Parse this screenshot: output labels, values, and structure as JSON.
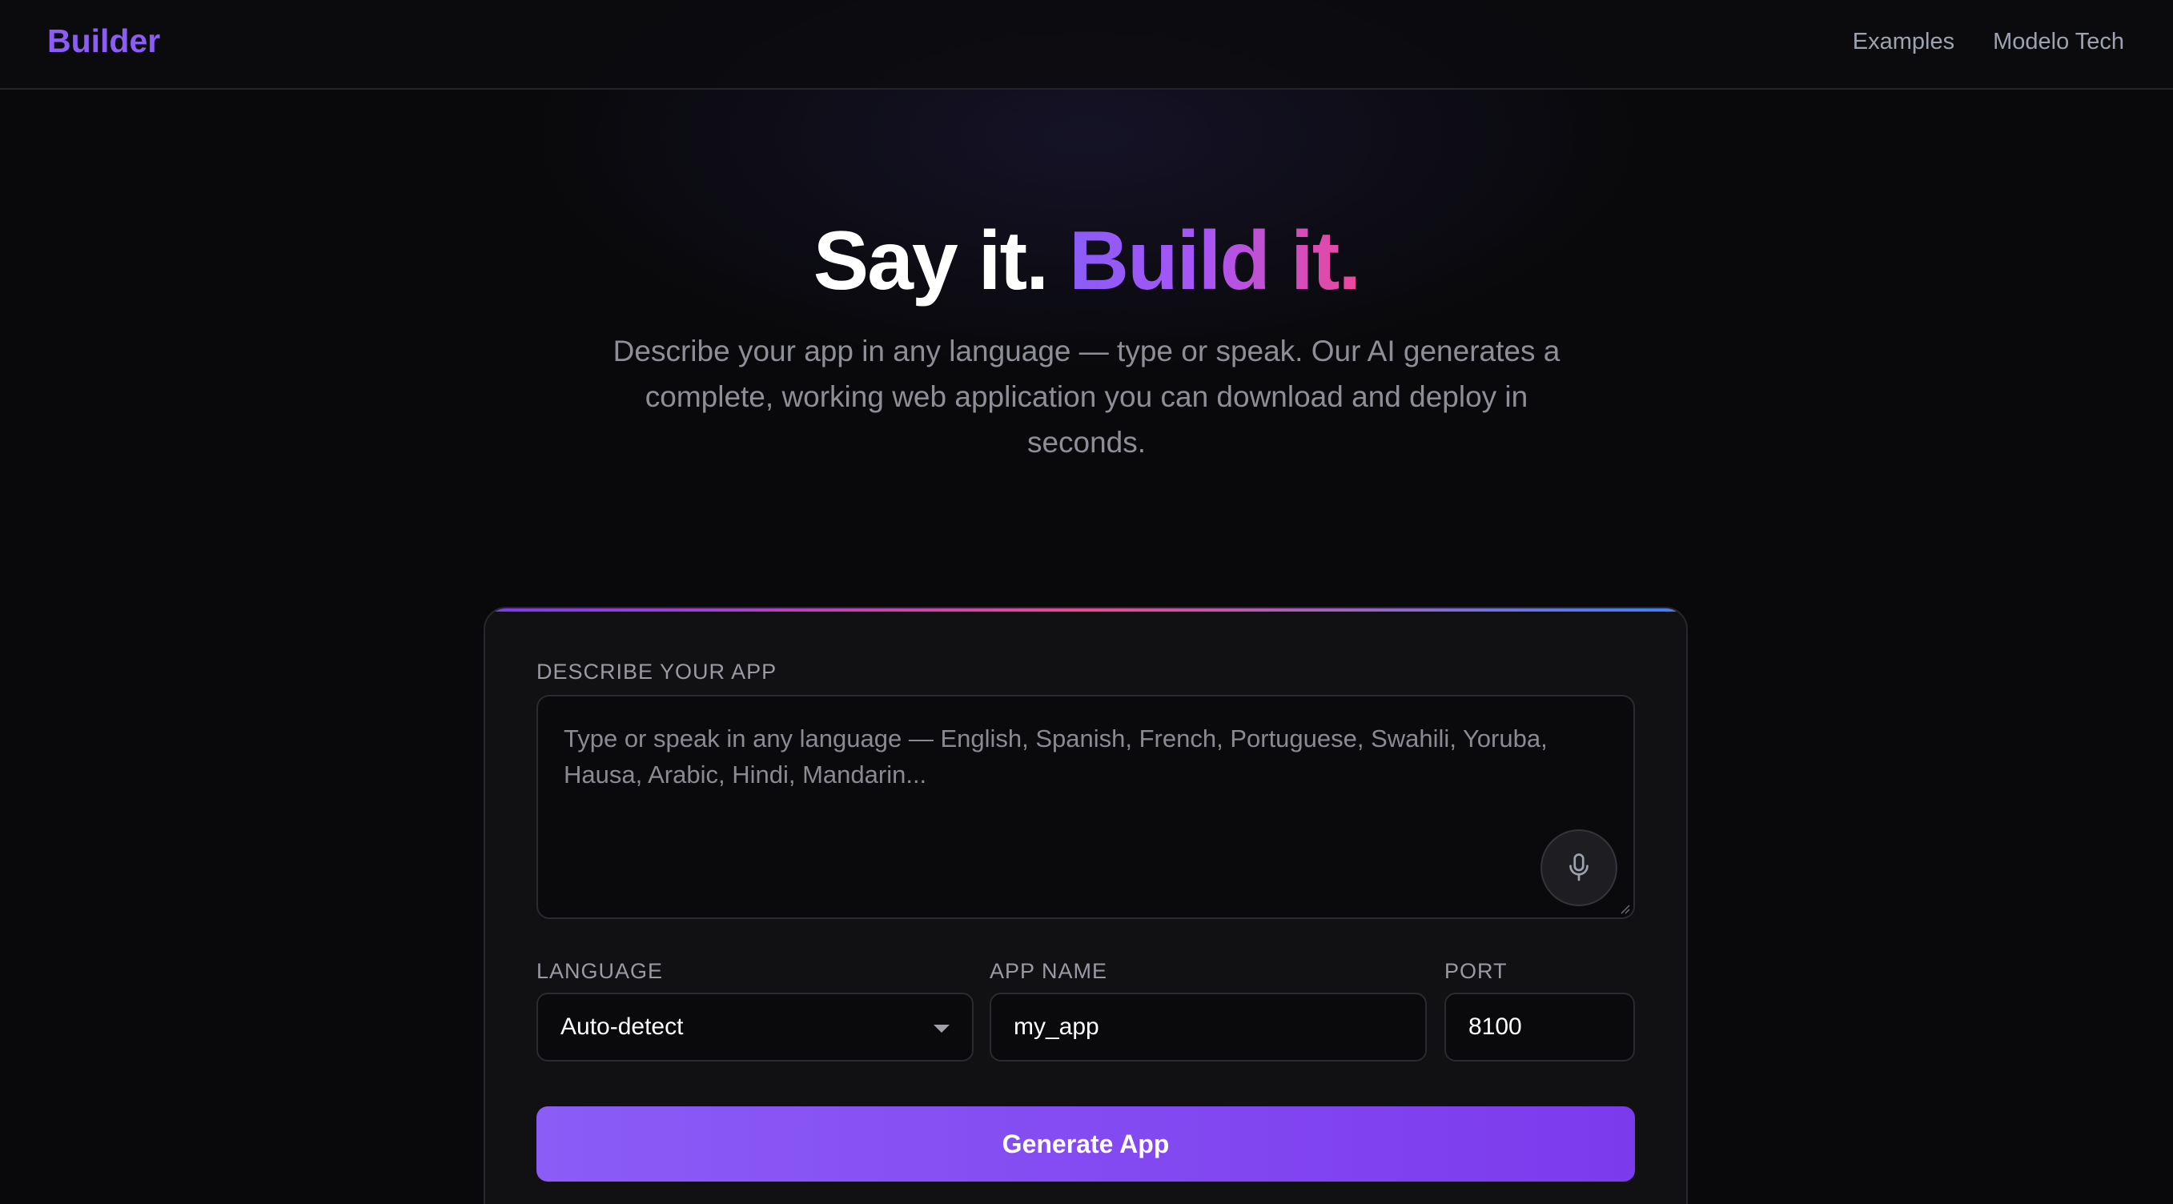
{
  "header": {
    "brand": "Builder",
    "nav": [
      "Examples",
      "Modelo Tech"
    ]
  },
  "hero": {
    "title_plain": "Say it.",
    "title_accent": "Build it.",
    "subtitle": "Describe your app in any language — type or speak. Our AI generates a complete, working web application you can download and deploy in seconds."
  },
  "form": {
    "describe_label": "DESCRIBE YOUR APP",
    "describe_placeholder": "Type or speak in any language — English, Spanish, French, Portuguese, Swahili, Yoruba, Hausa, Arabic, Hindi, Mandarin...",
    "language_label": "LANGUAGE",
    "language_value": "Auto-detect",
    "app_name_label": "APP NAME",
    "app_name_value": "my_app",
    "port_label": "PORT",
    "port_value": "8100",
    "generate_label": "Generate App",
    "mic_icon": "microphone-icon"
  },
  "colors": {
    "background": "#09090b",
    "brand": "#8b5cf6",
    "accent_gradient": [
      "#8b5cf6",
      "#ec4899"
    ],
    "button": "#7c3aed"
  }
}
